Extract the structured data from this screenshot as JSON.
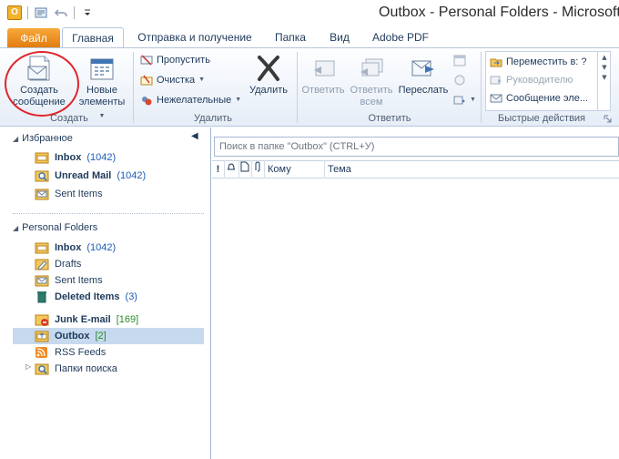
{
  "window": {
    "title": "Outbox - Personal Folders - Microsoft O",
    "app_icon_letter": "O"
  },
  "tabs": [
    {
      "label": "Файл"
    },
    {
      "label": "Главная"
    },
    {
      "label": "Отправка и получение"
    },
    {
      "label": "Папка"
    },
    {
      "label": "Вид"
    },
    {
      "label": "Adobe PDF"
    }
  ],
  "ribbon": {
    "groups": {
      "create": {
        "label": "Создать",
        "new_message": {
          "line1": "Создать",
          "line2": "сообщение",
          "icon": "new-email-icon"
        },
        "new_items": {
          "line1": "Новые",
          "line2": "элементы",
          "icon": "new-items-icon"
        }
      },
      "delete": {
        "label": "Удалить",
        "ignore": "Пропустить",
        "cleanup": "Очистка",
        "junk": "Нежелательные",
        "delete_button": "Удалить"
      },
      "respond": {
        "label": "Ответить",
        "reply": "Ответить",
        "reply_all_line1": "Ответить",
        "reply_all_line2": "всем",
        "forward": "Переслать"
      },
      "quick_steps": {
        "label": "Быстрые действия",
        "items": [
          "Переместить в: ?",
          "Руководителю",
          "Сообщение эле..."
        ]
      }
    }
  },
  "nav": {
    "favorites": {
      "title": "Избранное",
      "items": [
        {
          "name": "Inbox",
          "count": "(1042)",
          "bold": true
        },
        {
          "name": "Unread Mail",
          "count": "(1042)",
          "bold": true
        },
        {
          "name": "Sent Items",
          "count": "",
          "bold": false
        }
      ]
    },
    "personal": {
      "title": "Personal Folders",
      "items": [
        {
          "name": "Inbox",
          "count": "(1042)"
        },
        {
          "name": "Drafts",
          "count": ""
        },
        {
          "name": "Sent Items",
          "count": ""
        },
        {
          "name": "Deleted Items",
          "count": "(3)"
        },
        {
          "name": "Junk E-mail",
          "count": "[169]"
        },
        {
          "name": "Outbox",
          "count": "[2]"
        },
        {
          "name": "RSS Feeds",
          "count": ""
        },
        {
          "name": "Папки поиска",
          "count": ""
        }
      ]
    }
  },
  "main": {
    "search_placeholder": "Поиск в папке \"Outbox\" (CTRL+У)",
    "columns": {
      "importance": "!",
      "to": "Кому",
      "subject": "Тема"
    }
  }
}
